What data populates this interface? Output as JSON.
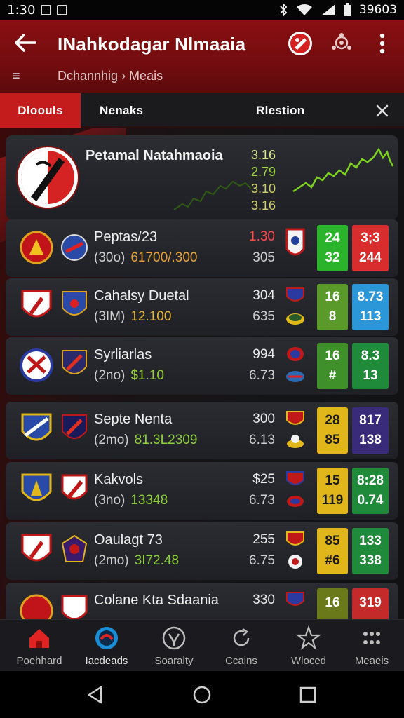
{
  "status_bar": {
    "time": "1:30",
    "battery_text": "39603"
  },
  "header": {
    "title": "INahkodagar Nlmaaia",
    "menu_glyph": "≡",
    "breadcrumb": "Dchannhig › Meais"
  },
  "tabs": [
    {
      "label": "Dloouls",
      "active": true
    },
    {
      "label": "Nenaks",
      "active": false
    },
    {
      "label": "Rlestion",
      "active": false
    }
  ],
  "feature": {
    "title": "Petamal Natahmaoia",
    "values": [
      "3.16",
      "2.79",
      "3.10",
      "3.16"
    ]
  },
  "rows": [
    {
      "name": "Peptas/23",
      "paren": "(30o)",
      "amount": "61700/.300",
      "amount_color": "#e7a23a",
      "v1": "1.30",
      "v2": "305",
      "v1_color": "#ff4a4a",
      "box1": [
        "24",
        "32"
      ],
      "box1_color": "#2bb32b",
      "box2": [
        "3;3",
        "244"
      ],
      "box2_color": "#d92d2d"
    },
    {
      "name": "Cahalsy Duetal",
      "paren": "(3IM)",
      "amount": "12.100",
      "amount_color": "#e7b73a",
      "v1": "304",
      "v2": "635",
      "v1_color": "#eaeaea",
      "box1": [
        "16",
        "8"
      ],
      "box1_color": "#5a9a2a",
      "box2": [
        "8.73",
        "113"
      ],
      "box2_color": "#2c97d8"
    },
    {
      "name": "Syrliarlas",
      "paren": "(2no)",
      "amount": "$1.10",
      "amount_color": "#9ad13a",
      "v1": "994",
      "v2": "6.73",
      "v1_color": "#eaeaea",
      "box1": [
        "16",
        "#"
      ],
      "box1_color": "#3f8f2a",
      "box2": [
        "8.3",
        "13"
      ],
      "box2_color": "#1f8a3a"
    },
    {
      "name": "Septe Nenta",
      "paren": "(2mo)",
      "amount": "81.3L2309",
      "amount_color": "#8fd13a",
      "v1": "300",
      "v2": "6.13",
      "v1_color": "#eaeaea",
      "box1": [
        "28",
        "85"
      ],
      "box1_color": "#e0b61a",
      "box2": [
        "817",
        "138"
      ],
      "box2_color": "#3a2a7a"
    },
    {
      "name": "Kakvols",
      "paren": "(3no)",
      "amount": "13348",
      "amount_color": "#8fd13a",
      "v1": "$25",
      "v2": "6.73",
      "v1_color": "#eaeaea",
      "box1": [
        "15",
        "119"
      ],
      "box1_color": "#e0b61a",
      "box2": [
        "8:28",
        "0.74"
      ],
      "box2_color": "#1f8a3a"
    },
    {
      "name": "Oaulagt 73",
      "paren": "(2mo)",
      "amount": "3I72.48",
      "amount_color": "#8fd13a",
      "v1": "255",
      "v2": "6.75",
      "v1_color": "#eaeaea",
      "box1": [
        "85",
        "#6"
      ],
      "box1_color": "#e0b61a",
      "box2": [
        "133",
        "338"
      ],
      "box2_color": "#1f8a3a"
    },
    {
      "name": "Colane Kta Sdaania",
      "paren": "",
      "amount": "",
      "amount_color": "#8fd13a",
      "v1": "330",
      "v2": "",
      "v1_color": "#eaeaea",
      "box1": [
        "16",
        ""
      ],
      "box1_color": "#6a7a1a",
      "box2": [
        "319",
        ""
      ],
      "box2_color": "#c42a2a"
    }
  ],
  "bottom_nav": [
    {
      "label": "Poehhard",
      "icon": "home-icon",
      "active": false
    },
    {
      "label": "Iacdeads",
      "icon": "live-icon",
      "active": true
    },
    {
      "label": "Soaralty",
      "icon": "trophy-icon",
      "active": false
    },
    {
      "label": "Ccains",
      "icon": "refresh-icon",
      "active": false
    },
    {
      "label": "Wloced",
      "icon": "star-icon",
      "active": false
    },
    {
      "label": "Meaeis",
      "icon": "grid-icon",
      "active": false
    }
  ],
  "colors": {
    "header": "#8a0f12",
    "active_tab": "#c41c1c",
    "sparkline": "#7ed321"
  }
}
